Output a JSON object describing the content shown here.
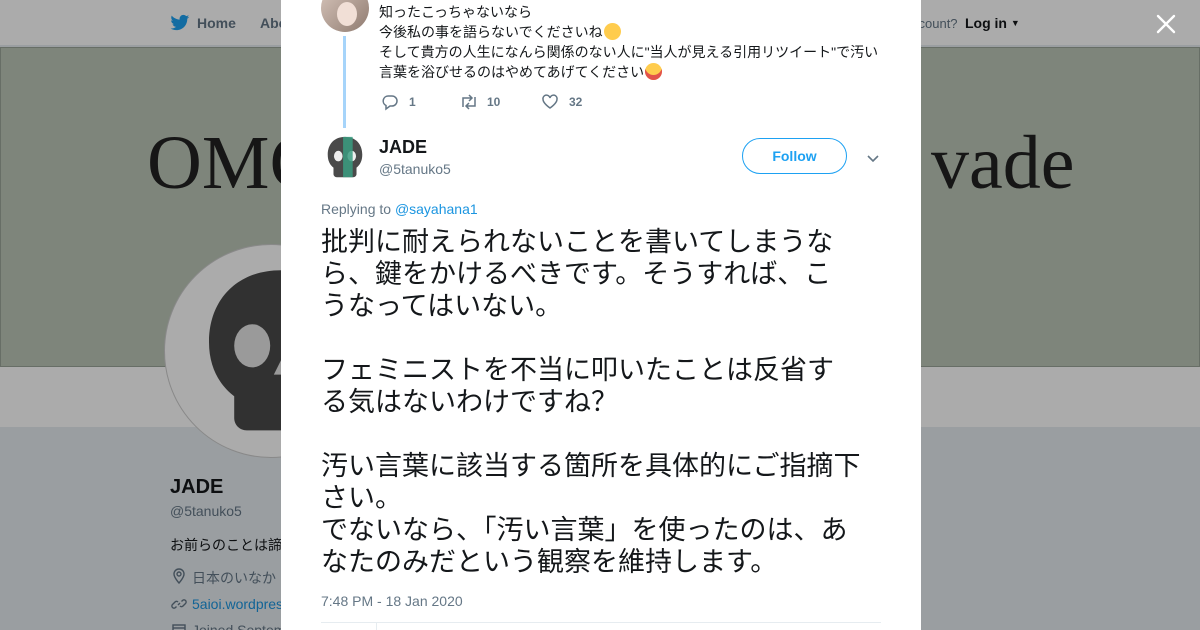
{
  "nav": {
    "home": "Home",
    "about": "Abo",
    "have_account": "ccount?",
    "login": "Log in"
  },
  "banner": {
    "left": "OMG",
    "right": "vade"
  },
  "profile": {
    "name": "JADE",
    "handle": "@5tanuko5",
    "bio": "お前らのことは諦",
    "location": "日本のいなか",
    "url": "5aioi.wordpres",
    "joined": "Joined Septem"
  },
  "parent_tweet": {
    "lines": [
      "知ったこっちゃないなら",
      "今後私の事を語らないでくださいね",
      "そして貴方の人生になんら関係のない人に\"当人が見える引用リツイート\"で汚い",
      "言葉を浴びせるのはやめてあげてください"
    ],
    "replies": "1",
    "retweets": "10",
    "likes": "32"
  },
  "tweet": {
    "name": "JADE",
    "handle": "@5tanuko5",
    "follow_label": "Follow",
    "replying_prefix": "Replying to",
    "replying_to": "@sayahana1",
    "lines": [
      "批判に耐えられないことを書いてしまうな",
      "ら、鍵をかけるべきです。そうすれば、こ",
      "うなってはいない。",
      "",
      "フェミニストを不当に叩いたことは反省す",
      "る気はないわけですね？",
      "",
      "汚い言葉に該当する箇所を具体的にご指摘下",
      "さい。",
      "でないなら、「汚い言葉」を使ったのは、あ",
      "なたのみだという観察を維持します。"
    ],
    "timestamp": "7:48 PM - 18 Jan 2020"
  },
  "colors": {
    "accent": "#1da1f2",
    "thread_line": "#a6d4fa",
    "banner_bg": "#bcc6b8"
  },
  "icons": [
    "twitter-bird-icon",
    "close-icon",
    "reply-icon",
    "retweet-icon",
    "like-icon",
    "chevron-down-icon",
    "location-icon",
    "link-icon",
    "calendar-icon"
  ]
}
